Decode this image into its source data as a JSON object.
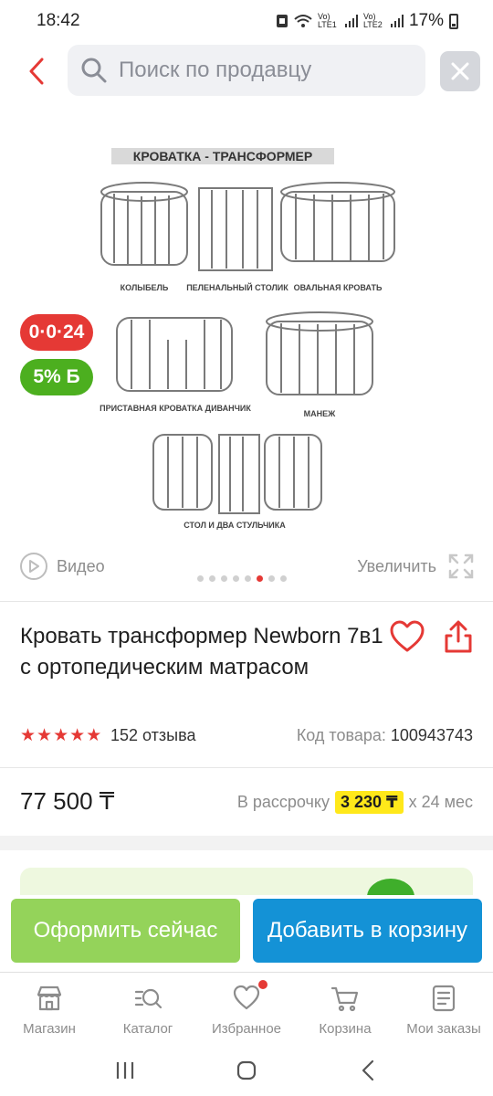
{
  "status_bar": {
    "time": "18:42",
    "network1": "Vo) LTE1",
    "network2": "Vo) LTE2",
    "battery_percent": "17%"
  },
  "header": {
    "search_placeholder": "Поиск по продавцу"
  },
  "gallery": {
    "image_title": "КРОВАТКА - ТРАНСФОРМЕР",
    "image_labels": [
      "КОЛЫБЕЛЬ",
      "ПЕЛЕНАЛЬНЫЙ СТОЛИК",
      "ОВАЛЬНАЯ КРОВАТЬ",
      "ПРИСТАВНАЯ КРОВАТКА ДИВАНЧИК",
      "МАНЕЖ",
      "СТОЛ И ДВА СТУЛЬЧИКА"
    ],
    "badge_installment": "0·0·24",
    "badge_bonus": "5% Б",
    "video_label": "Видео",
    "zoom_label": "Увеличить",
    "dots_total": 8,
    "active_dot_index": 5
  },
  "product": {
    "title": "Кровать трансформер Newborn 7в1 с ортопедическим матрасом",
    "rating": 5,
    "reviews": "152 отзыва",
    "sku_label": "Код товара:",
    "sku_value": "100943743",
    "price": "77 500 ₸",
    "installment_label": "В рассрочку",
    "installment_amount": "3 230 ₸",
    "installment_term": "х 24 мес"
  },
  "actions": {
    "buy_now": "Оформить сейчас",
    "add_to_cart": "Добавить в корзину"
  },
  "bottom_nav": {
    "items": [
      {
        "label": "Магазин",
        "icon": "store-icon"
      },
      {
        "label": "Каталог",
        "icon": "catalog-search-icon"
      },
      {
        "label": "Избранное",
        "icon": "heart-icon"
      },
      {
        "label": "Корзина",
        "icon": "cart-icon"
      },
      {
        "label": "Мои заказы",
        "icon": "orders-icon"
      }
    ]
  },
  "colors": {
    "accent_red": "#e53935",
    "bonus_green": "#4caf1f",
    "buy_button": "#94d35a",
    "cart_button": "#1492d6",
    "installment_highlight": "#ffe81a"
  }
}
